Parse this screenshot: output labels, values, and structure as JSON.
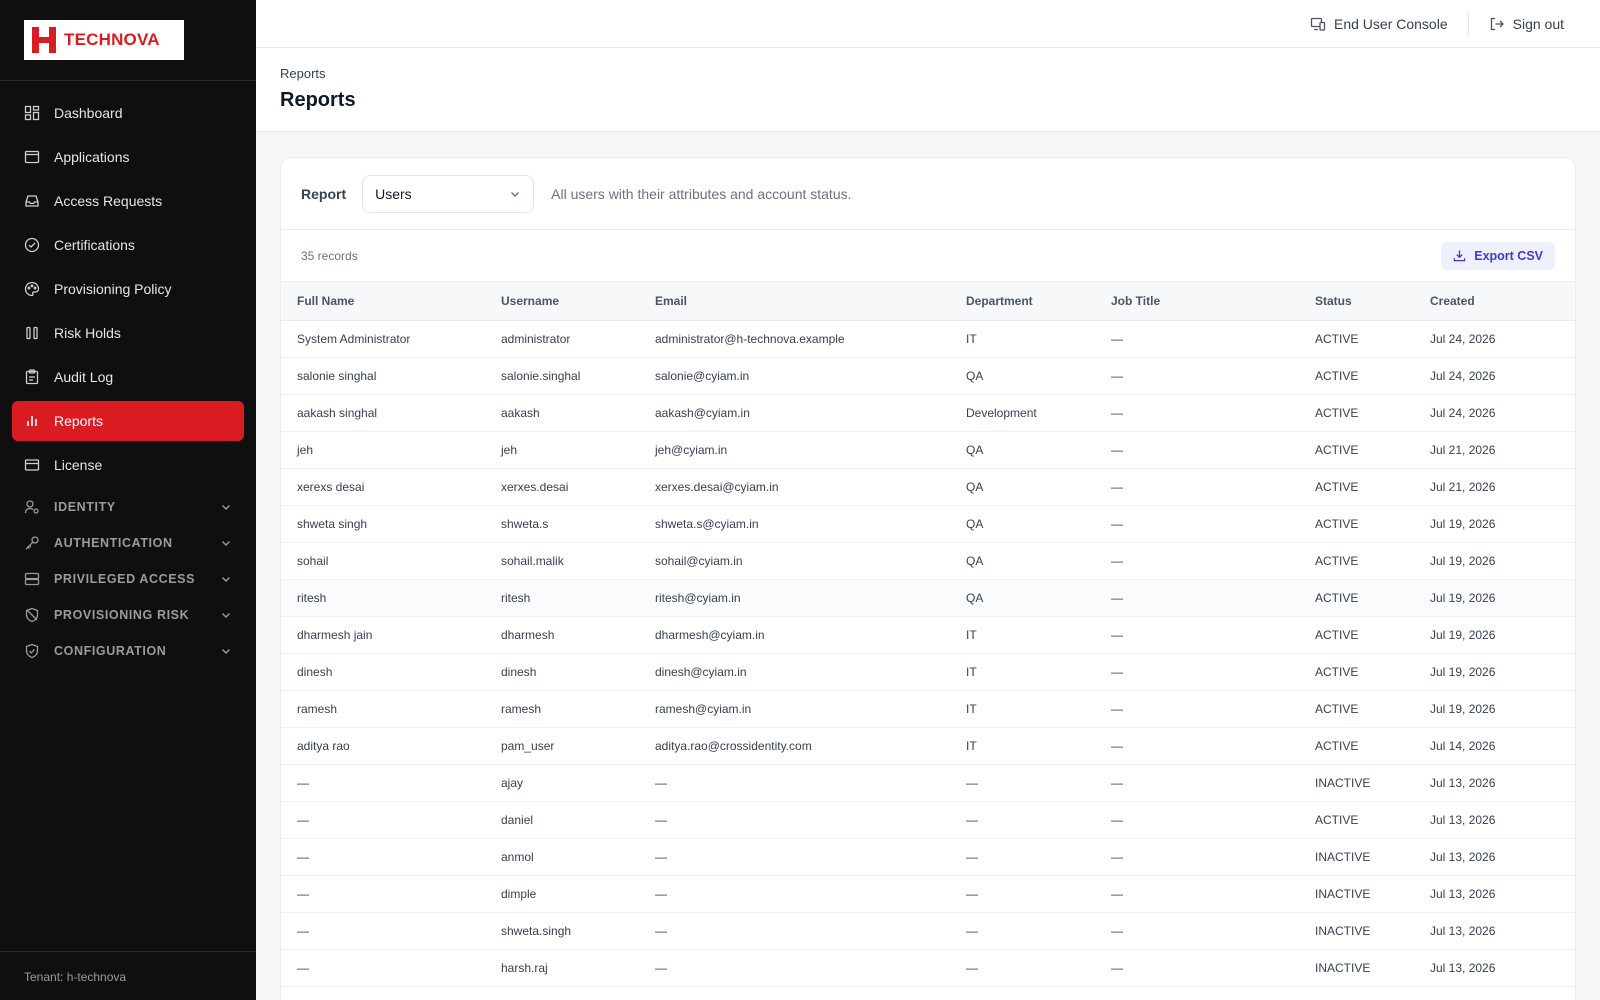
{
  "brand": {
    "name": "TECHNOVA",
    "color": "#d91c21"
  },
  "sidebar": {
    "items": [
      {
        "label": "Dashboard",
        "icon": "dashboard-icon",
        "active": false
      },
      {
        "label": "Applications",
        "icon": "window-icon",
        "active": false
      },
      {
        "label": "Access Requests",
        "icon": "inbox-icon",
        "active": false
      },
      {
        "label": "Certifications",
        "icon": "check-circle-icon",
        "active": false
      },
      {
        "label": "Provisioning Policy",
        "icon": "palette-icon",
        "active": false
      },
      {
        "label": "Risk Holds",
        "icon": "pause-icon",
        "active": false
      },
      {
        "label": "Audit Log",
        "icon": "clipboard-icon",
        "active": false
      },
      {
        "label": "Reports",
        "icon": "bar-chart-icon",
        "active": true
      },
      {
        "label": "License",
        "icon": "card-icon",
        "active": false
      }
    ],
    "groups": [
      {
        "label": "IDENTITY",
        "icon": "user-gear-icon"
      },
      {
        "label": "AUTHENTICATION",
        "icon": "key-icon"
      },
      {
        "label": "PRIVILEGED ACCESS",
        "icon": "server-icon"
      },
      {
        "label": "PROVISIONING RISK",
        "icon": "shield-off-icon"
      },
      {
        "label": "CONFIGURATION",
        "icon": "shield-check-icon"
      }
    ],
    "tenant": "Tenant: h-technova"
  },
  "topbar": {
    "end_user_console": "End User Console",
    "sign_out": "Sign out"
  },
  "page": {
    "breadcrumb": "Reports",
    "title": "Reports"
  },
  "report": {
    "label": "Report",
    "selected": "Users",
    "description": "All users with their attributes and account status.",
    "records": "35 records",
    "export_label": "Export CSV"
  },
  "table": {
    "columns": [
      "Full Name",
      "Username",
      "Email",
      "Department",
      "Job Title",
      "Status",
      "Created"
    ],
    "rows": [
      [
        "System Administrator",
        "administrator",
        "administrator@h-technova.example",
        "IT",
        "—",
        "ACTIVE",
        "Jul 24, 2026"
      ],
      [
        "salonie singhal",
        "salonie.singhal",
        "salonie@cyiam.in",
        "QA",
        "—",
        "ACTIVE",
        "Jul 24, 2026"
      ],
      [
        "aakash singhal",
        "aakash",
        "aakash@cyiam.in",
        "Development",
        "—",
        "ACTIVE",
        "Jul 24, 2026"
      ],
      [
        "jeh",
        "jeh",
        "jeh@cyiam.in",
        "QA",
        "—",
        "ACTIVE",
        "Jul 21, 2026"
      ],
      [
        "xerexs desai",
        "xerxes.desai",
        "xerxes.desai@cyiam.in",
        "QA",
        "—",
        "ACTIVE",
        "Jul 21, 2026"
      ],
      [
        "shweta singh",
        "shweta.s",
        "shweta.s@cyiam.in",
        "QA",
        "—",
        "ACTIVE",
        "Jul 19, 2026"
      ],
      [
        "sohail",
        "sohail.malik",
        "sohail@cyiam.in",
        "QA",
        "—",
        "ACTIVE",
        "Jul 19, 2026"
      ],
      [
        "ritesh",
        "ritesh",
        "ritesh@cyiam.in",
        "QA",
        "—",
        "ACTIVE",
        "Jul 19, 2026"
      ],
      [
        "dharmesh jain",
        "dharmesh",
        "dharmesh@cyiam.in",
        "IT",
        "—",
        "ACTIVE",
        "Jul 19, 2026"
      ],
      [
        "dinesh",
        "dinesh",
        "dinesh@cyiam.in",
        "IT",
        "—",
        "ACTIVE",
        "Jul 19, 2026"
      ],
      [
        "ramesh",
        "ramesh",
        "ramesh@cyiam.in",
        "IT",
        "—",
        "ACTIVE",
        "Jul 19, 2026"
      ],
      [
        "aditya rao",
        "pam_user",
        "aditya.rao@crossidentity.com",
        "IT",
        "—",
        "ACTIVE",
        "Jul 14, 2026"
      ],
      [
        "—",
        "ajay",
        "—",
        "—",
        "—",
        "INACTIVE",
        "Jul 13, 2026"
      ],
      [
        "—",
        "daniel",
        "—",
        "—",
        "—",
        "ACTIVE",
        "Jul 13, 2026"
      ],
      [
        "—",
        "anmol",
        "—",
        "—",
        "—",
        "INACTIVE",
        "Jul 13, 2026"
      ],
      [
        "—",
        "dimple",
        "—",
        "—",
        "—",
        "INACTIVE",
        "Jul 13, 2026"
      ],
      [
        "—",
        "shweta.singh",
        "—",
        "—",
        "—",
        "INACTIVE",
        "Jul 13, 2026"
      ],
      [
        "—",
        "harsh.raj",
        "—",
        "—",
        "—",
        "INACTIVE",
        "Jul 13, 2026"
      ]
    ]
  }
}
